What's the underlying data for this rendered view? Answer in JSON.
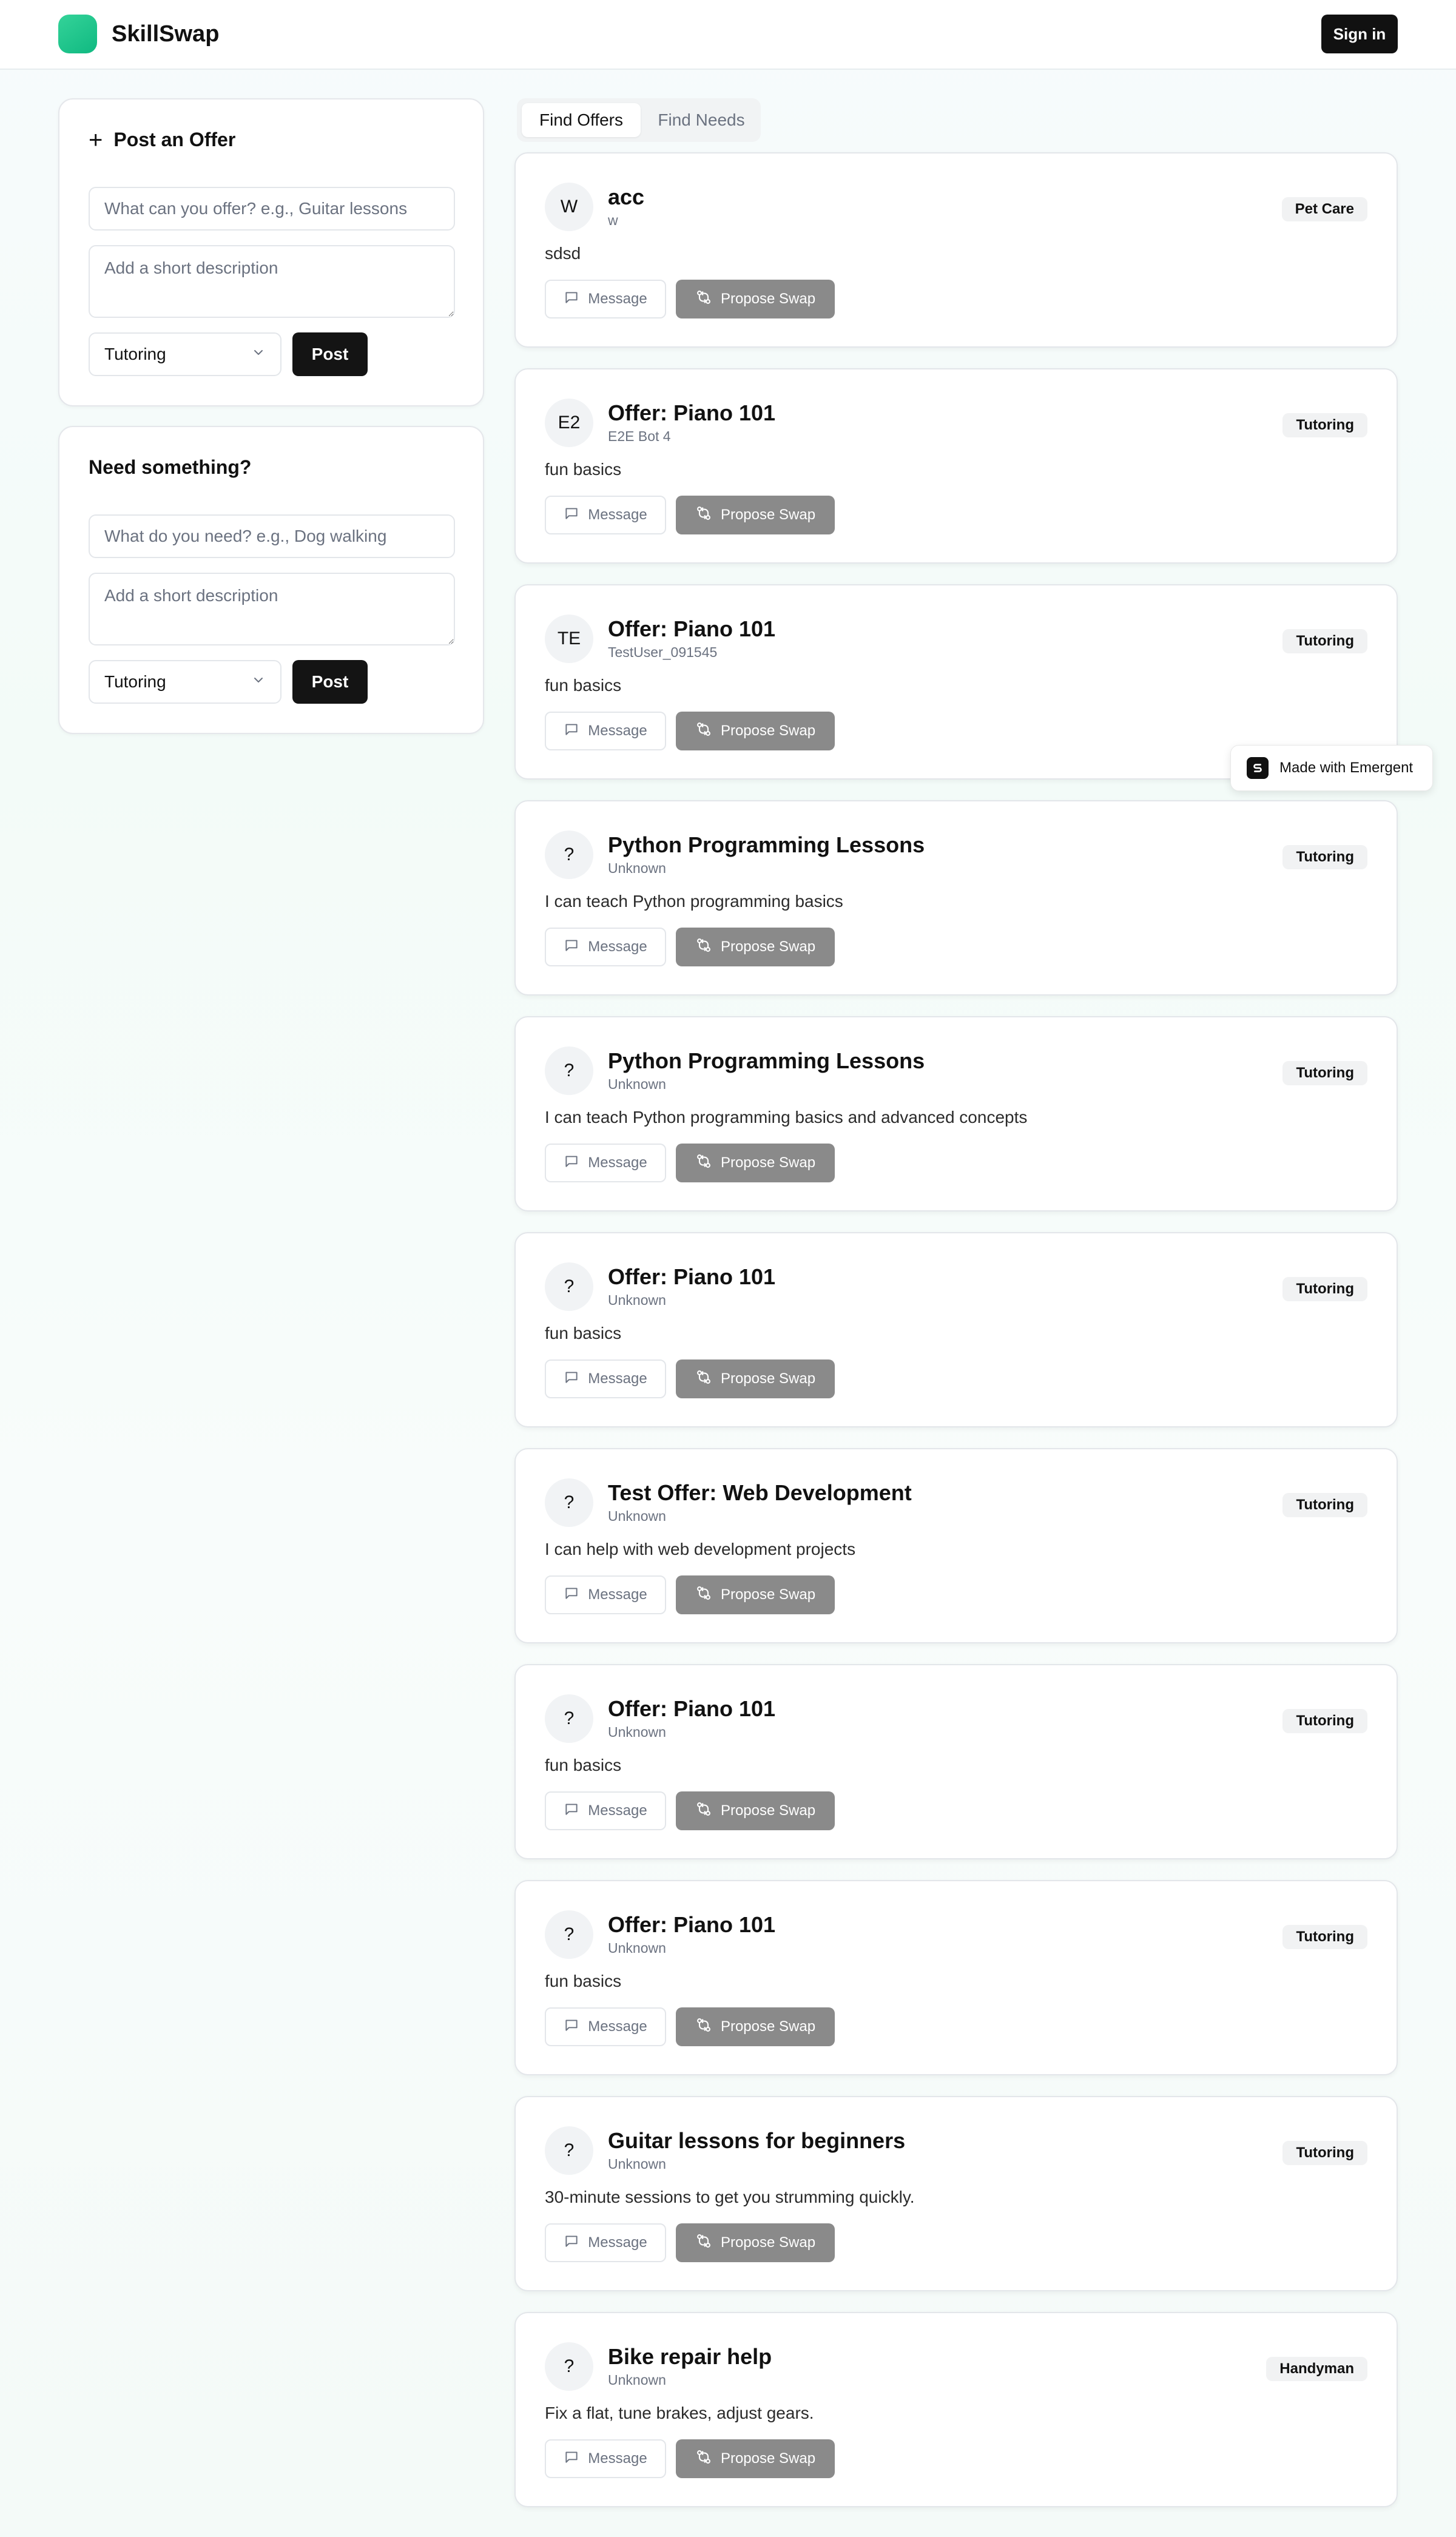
{
  "header": {
    "brand": "SkillSwap",
    "signin_label": "Sign in"
  },
  "offer_panel": {
    "title": "Post an Offer",
    "title_placeholder": "What can you offer? e.g., Guitar lessons",
    "desc_placeholder": "Add a short description",
    "category": "Tutoring",
    "post_label": "Post"
  },
  "need_panel": {
    "title": "Need something?",
    "title_placeholder": "What do you need? e.g., Dog walking",
    "desc_placeholder": "Add a short description",
    "category": "Tutoring",
    "post_label": "Post"
  },
  "tabs": [
    {
      "label": "Find Offers",
      "active": true
    },
    {
      "label": "Find Needs",
      "active": false
    }
  ],
  "buttons": {
    "message": "Message",
    "propose": "Propose Swap"
  },
  "cards": [
    {
      "avatar": "W",
      "title": "acc",
      "user": "w",
      "desc": "sdsd",
      "category": "Pet Care"
    },
    {
      "avatar": "E2",
      "title": "Offer: Piano 101",
      "user": "E2E Bot 4",
      "desc": "fun basics",
      "category": "Tutoring"
    },
    {
      "avatar": "TE",
      "title": "Offer: Piano 101",
      "user": "TestUser_091545",
      "desc": "fun basics",
      "category": "Tutoring"
    },
    {
      "avatar": "?",
      "title": "Python Programming Lessons",
      "user": "Unknown",
      "desc": "I can teach Python programming basics",
      "category": "Tutoring"
    },
    {
      "avatar": "?",
      "title": "Python Programming Lessons",
      "user": "Unknown",
      "desc": "I can teach Python programming basics and advanced concepts",
      "category": "Tutoring"
    },
    {
      "avatar": "?",
      "title": "Offer: Piano 101",
      "user": "Unknown",
      "desc": "fun basics",
      "category": "Tutoring"
    },
    {
      "avatar": "?",
      "title": "Test Offer: Web Development",
      "user": "Unknown",
      "desc": "I can help with web development projects",
      "category": "Tutoring"
    },
    {
      "avatar": "?",
      "title": "Offer: Piano 101",
      "user": "Unknown",
      "desc": "fun basics",
      "category": "Tutoring"
    },
    {
      "avatar": "?",
      "title": "Offer: Piano 101",
      "user": "Unknown",
      "desc": "fun basics",
      "category": "Tutoring"
    },
    {
      "avatar": "?",
      "title": "Guitar lessons for beginners",
      "user": "Unknown",
      "desc": "30-minute sessions to get you strumming quickly.",
      "category": "Tutoring"
    },
    {
      "avatar": "?",
      "title": "Bike repair help",
      "user": "Unknown",
      "desc": "Fix a flat, tune brakes, adjust gears.",
      "category": "Handyman"
    }
  ],
  "made_with": "Made with Emergent"
}
